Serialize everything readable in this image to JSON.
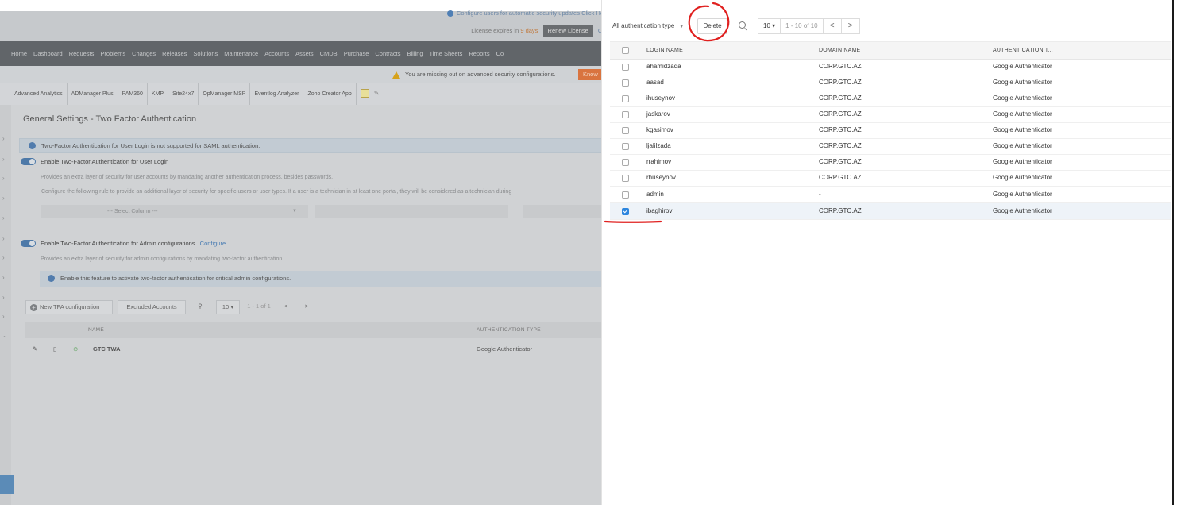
{
  "header": {
    "notice": "Configure users for automatic security updates Click He",
    "license_prefix": "License expires in",
    "license_days": "9 days",
    "renew_label": "Renew License",
    "close_label": "Cl"
  },
  "nav": [
    "Home",
    "Dashboard",
    "Requests",
    "Problems",
    "Changes",
    "Releases",
    "Solutions",
    "Maintenance",
    "Accounts",
    "Assets",
    "CMDB",
    "Purchase",
    "Contracts",
    "Billing",
    "Time Sheets",
    "Reports",
    "Co"
  ],
  "warning": {
    "text": "You are missing out on advanced security configurations.",
    "button": "Know"
  },
  "apps": [
    "Advanced Analytics",
    "ADManager Plus",
    "PAM360",
    "KMP",
    "Site24x7",
    "OpManager MSP",
    "Eventlog Analyzer",
    "Zoho Creator App"
  ],
  "settings": {
    "title": "General Settings - Two Factor Authentication",
    "saml_info": "Two-Factor Authentication for User Login is not supported for SAML authentication.",
    "user_login_label": "Enable Two-Factor Authentication for User Login",
    "user_login_desc": "Provides an extra layer of security for user accounts by mandating another authentication process, besides passwords.",
    "rule_desc": "Configure the following rule to provide an additional layer of security for specific users or user types. If a user is a technician in at least one portal, they will be considered as a technician during",
    "select_placeholder": "--- Select Column ---",
    "admin_label": "Enable Two-Factor Authentication for Admin configurations",
    "admin_configure": "Configure",
    "admin_desc": "Provides an extra layer of security for admin configurations by mandating two-factor authentication.",
    "admin_info": "Enable this feature to activate two-factor authentication for critical admin configurations.",
    "toolbar": {
      "new_label": "New TFA configuration",
      "excluded_label": "Excluded Accounts",
      "page_size": "10 ▾",
      "range": "1 - 1 of 1"
    },
    "table": {
      "col_name": "NAME",
      "col_auth": "AUTHENTICATION TYPE",
      "row": {
        "name": "GTC TWA",
        "auth": "Google Authenticator"
      }
    }
  },
  "panel": {
    "filter_label": "All authentication type",
    "delete_label": "Delete",
    "page_size": "10 ▾",
    "range": "1 - 10 of 10",
    "prev": "<",
    "next": ">",
    "columns": {
      "login": "LOGIN NAME",
      "domain": "DOMAIN NAME",
      "auth": "AUTHENTICATION T..."
    },
    "rows": [
      {
        "login": "ahamidzada",
        "domain": "CORP.GTC.AZ",
        "auth": "Google Authenticator",
        "checked": false
      },
      {
        "login": "aasad",
        "domain": "CORP.GTC.AZ",
        "auth": "Google Authenticator",
        "checked": false
      },
      {
        "login": "ihuseynov",
        "domain": "CORP.GTC.AZ",
        "auth": "Google Authenticator",
        "checked": false
      },
      {
        "login": "jaskarov",
        "domain": "CORP.GTC.AZ",
        "auth": "Google Authenticator",
        "checked": false
      },
      {
        "login": "kgasimov",
        "domain": "CORP.GTC.AZ",
        "auth": "Google Authenticator",
        "checked": false
      },
      {
        "login": "ljalilzada",
        "domain": "CORP.GTC.AZ",
        "auth": "Google Authenticator",
        "checked": false
      },
      {
        "login": "rrahimov",
        "domain": "CORP.GTC.AZ",
        "auth": "Google Authenticator",
        "checked": false
      },
      {
        "login": "rhuseynov",
        "domain": "CORP.GTC.AZ",
        "auth": "Google Authenticator",
        "checked": false
      },
      {
        "login": "admin",
        "domain": "-",
        "auth": "Google Authenticator",
        "checked": false
      },
      {
        "login": "ibaghirov",
        "domain": "CORP.GTC.AZ",
        "auth": "Google Authenticator",
        "checked": true
      }
    ]
  },
  "colors": {
    "accent": "#2e86de",
    "annotation": "#e0201f",
    "nav_bg": "#616569"
  }
}
